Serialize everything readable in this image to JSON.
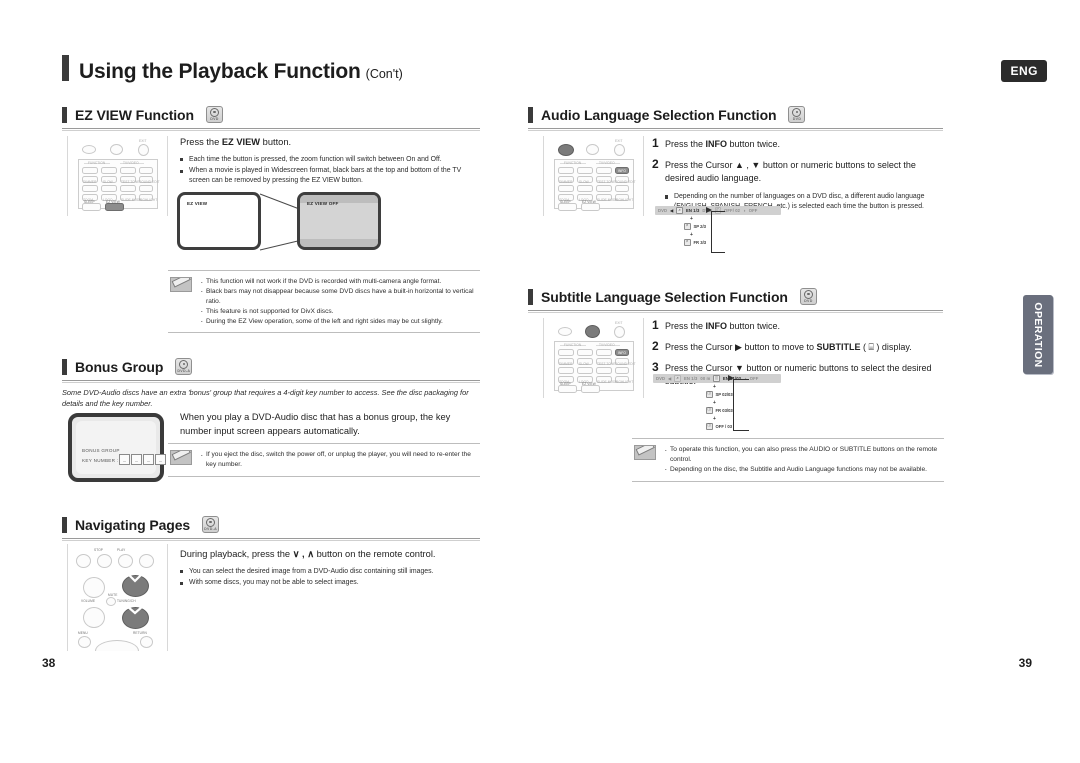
{
  "header": {
    "title": "Using the Playback Function",
    "title_suffix": "(Con't)",
    "language_badge": "ENG"
  },
  "side_tab": {
    "label": "OPERATION"
  },
  "pages": {
    "left": "38",
    "right": "39"
  },
  "sections": {
    "ez_view": {
      "heading": "EZ VIEW Function",
      "disc_icon": "dvd-disc-icon",
      "lead_prefix": "Press the ",
      "lead_bold": "EZ VIEW",
      "lead_suffix": " button.",
      "bullets": [
        "Each time the button is pressed, the zoom function will switch between On and Off.",
        "When a movie is played in Widescreen format, black bars at the top and bottom of the TV screen can be removed by pressing the EZ VIEW button."
      ],
      "tv_left_label": "EZ VIEW",
      "tv_right_label": "EZ VIEW OFF",
      "notes": [
        "This function will not work if the DVD is recorded with multi-camera angle format.",
        "Black bars may not disappear because some DVD discs have a built-in horizontal to vertical ratio.",
        "This feature is not supported for DivX discs.",
        "During the EZ View operation, some of the left and right sides may be cut slightly."
      ]
    },
    "bonus_group": {
      "heading": "Bonus Group",
      "disc_icon": "dvd-audio-disc-icon",
      "intro": "Some DVD-Audio discs have an extra 'bonus' group that requires a 4-digit key number to access. See the disc packaging for details and the key number.",
      "lead": "When you play a DVD-Audio disc that has a bonus group, the key number input screen appears automatically.",
      "tv_label_1": "BONUS GROUP",
      "tv_label_2": "KEY NUMBER :",
      "key_boxes": [
        "_",
        "_",
        "_",
        "_"
      ],
      "notes": [
        "If you eject the disc, switch the power off, or unplug the player, you will need to re-enter the key number."
      ]
    },
    "navigating_pages": {
      "heading": "Navigating Pages",
      "disc_icon": "dvd-audio-disc-icon",
      "lead_prefix": "During playback, press the ",
      "lead_glyph": "∨ , ∧",
      "lead_suffix": " button on the remote control.",
      "bullets": [
        "You can select the desired image from a DVD-Audio disc containing still images.",
        "With some discs, you may not be able to select images."
      ],
      "remote_labels": {
        "stop": "STOP",
        "play": "PLAY",
        "volume": "VOLUME",
        "mute": "MUTE",
        "tuning": "TUNING/CH",
        "menu": "MENU",
        "return": "RETURN"
      }
    },
    "audio_language": {
      "heading": "Audio Language Selection Function",
      "disc_icon": "dvd-disc-icon",
      "steps": [
        {
          "num": "1",
          "prefix": "Press the ",
          "bold": "INFO",
          "suffix": " button twice."
        },
        {
          "num": "2",
          "prefix": "Press the Cursor ▲ , ▼ button or numeric buttons to select the desired audio language.",
          "bold": "",
          "suffix": ""
        }
      ],
      "bullets": [
        "Depending on the number of languages on a DVD disc, a different audio language (ENGLISH, SPANISH, FRENCH, etc.) is selected each time the button is pressed."
      ],
      "osd": {
        "prefix": "DVD",
        "arrow": "◀",
        "active": "EN 1/3",
        "dim1": "DVD",
        "dim2": "OFF/ 02",
        "dim3": "OFF",
        "options": [
          "SP 2/3",
          "FR 3/3"
        ]
      }
    },
    "subtitle_language": {
      "heading": "Subtitle Language Selection Function",
      "disc_icon": "dvd-disc-icon",
      "steps": [
        {
          "num": "1",
          "prefix": "Press the ",
          "bold": "INFO",
          "suffix": " button twice."
        },
        {
          "num": "2",
          "prefix": "Press the Cursor ▶ button to move to ",
          "bold": "SUBTITLE",
          "suffix": " ( ⌸ ) display."
        },
        {
          "num": "3",
          "prefix": "Press the Cursor ▼ button or numeric buttons to select the desired subtitle.",
          "bold": "",
          "suffix": ""
        }
      ],
      "osd": {
        "prefix": "DVD",
        "arrow": "◀",
        "dim_a": "EN 1/3",
        "dim_b": "00 m",
        "active": "EN 01/03",
        "dim_c": "OFF",
        "options": [
          "SP 02/03",
          "FR 03/03",
          "OFF / 03"
        ]
      },
      "notes": [
        "To operate this function, you can also press the AUDIO or SUBTITLE buttons on the remote control.",
        "Depending on the disc, the Subtitle and Audio Language functions may not be available."
      ]
    }
  },
  "remote_top": {
    "group_label_1": "FUNCTION",
    "group_label_2": "TV/VIDEO",
    "exit_label": "EXIT",
    "buttons": [
      "MODE",
      "EFFECT",
      "INFO",
      "DIMMER",
      "SLOW",
      "TEST TONE",
      "SOUND EDIT",
      "ECHO",
      "MO/ST",
      "SUBWOOFER",
      "DVD/EXIT",
      "SLEEP",
      "EZ VIEW",
      "ZOOM",
      "LOGO",
      "S.VOL",
      "P.BASS",
      "REPEAT"
    ]
  },
  "colors": {
    "accent_dark": "#3b3b3b",
    "badge_bg": "#2b2b2b",
    "tab_bg": "#6a6f7d",
    "rule": "#9a9a9a"
  }
}
